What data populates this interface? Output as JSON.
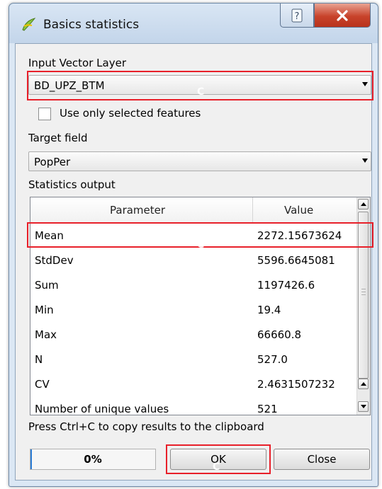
{
  "window": {
    "title": "Basics statistics",
    "icons": {
      "app": "qgis-icon",
      "help": "help-icon",
      "close": "close-icon"
    }
  },
  "input_layer": {
    "label": "Input Vector Layer",
    "value": "BD_UPZ_BTM",
    "selected_only_label": "Use only selected features",
    "selected_only_checked": false
  },
  "target_field": {
    "label": "Target field",
    "value": "PopPer"
  },
  "statistics": {
    "label": "Statistics output",
    "columns": [
      "Parameter",
      "Value"
    ],
    "rows": [
      {
        "parameter": "Mean",
        "value": "2272.15673624"
      },
      {
        "parameter": "StdDev",
        "value": "5596.6645081"
      },
      {
        "parameter": "Sum",
        "value": "1197426.6"
      },
      {
        "parameter": "Min",
        "value": "19.4"
      },
      {
        "parameter": "Max",
        "value": "66660.8"
      },
      {
        "parameter": "N",
        "value": "527.0"
      },
      {
        "parameter": "CV",
        "value": "2.4631507232"
      },
      {
        "parameter": "Number of unique values",
        "value": "521"
      }
    ]
  },
  "hint": "Press Ctrl+C to copy results to the clipboard",
  "progress": {
    "text": "0%",
    "value": 0.01
  },
  "buttons": {
    "ok": "OK",
    "close": "Close"
  },
  "annotation": {
    "color": "#e8202a",
    "mark": "C"
  }
}
